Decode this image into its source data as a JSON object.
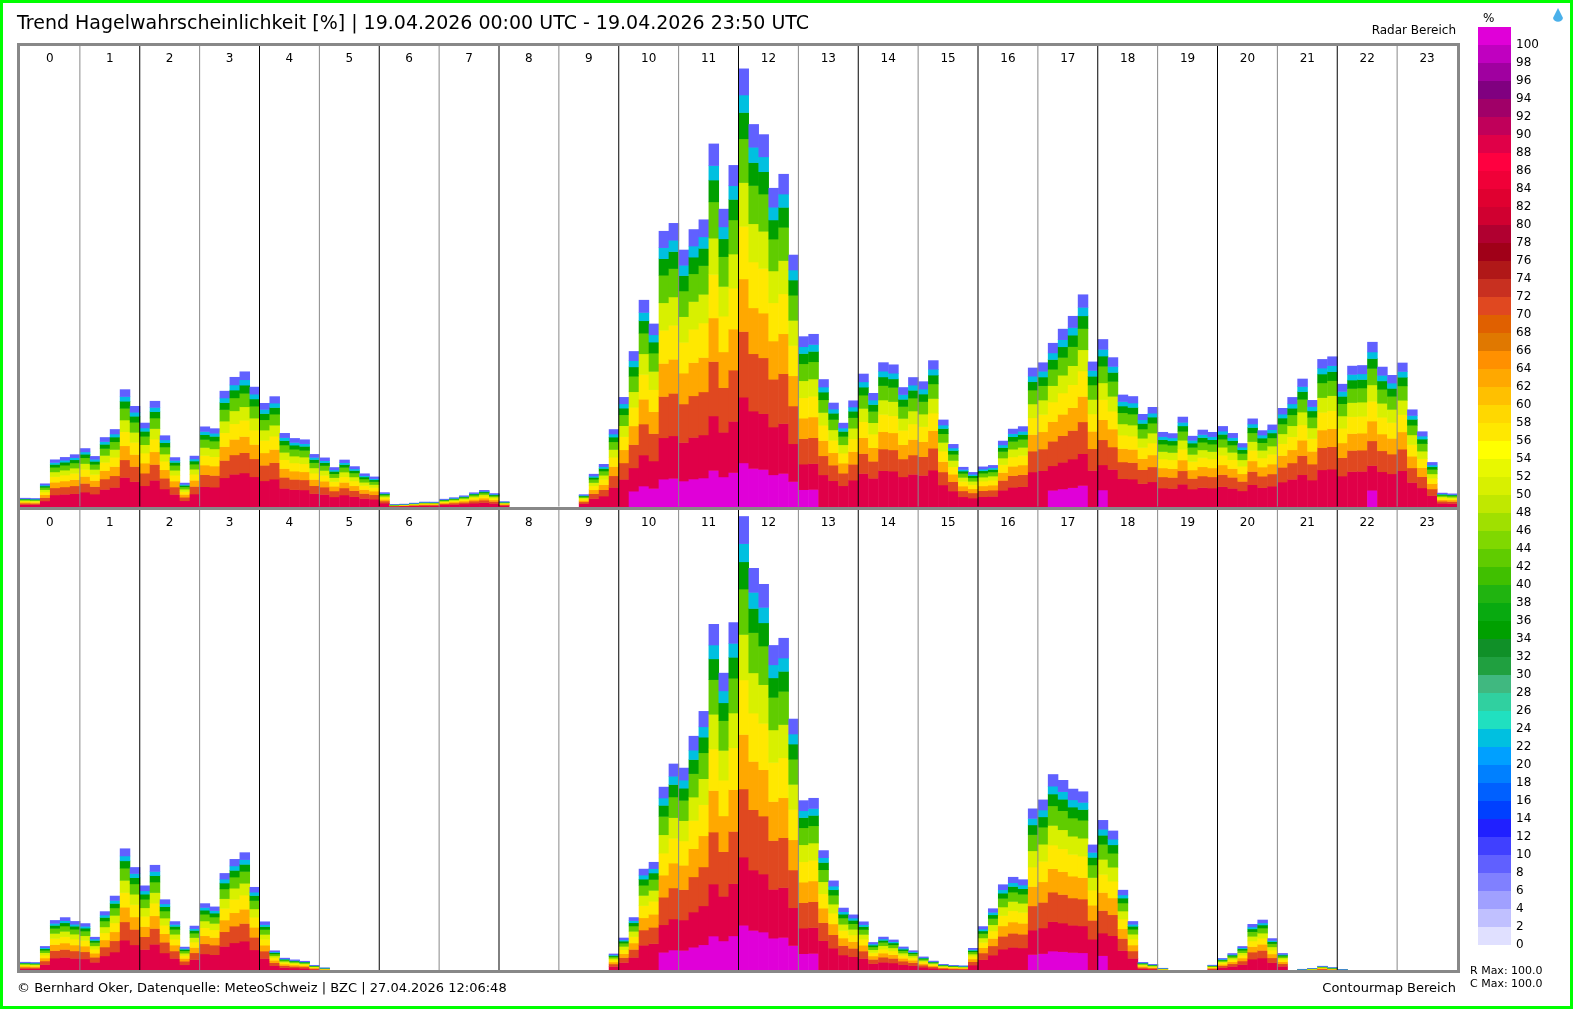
{
  "title": "Trend Hagelwahrscheinlichkeit [%] | 19.04.2026 00:00 UTC - 19.04.2026 23:50 UTC",
  "area_label_top": "Radar Bereich",
  "panels": [
    {
      "hours": [
        "0",
        "1",
        "2",
        "3",
        "4",
        "5",
        "6",
        "7",
        "8",
        "9",
        "10",
        "11",
        "12",
        "13",
        "14",
        "15",
        "16",
        "17",
        "18",
        "19",
        "20",
        "21",
        "22",
        "23"
      ]
    },
    {
      "hours": [
        "0",
        "1",
        "2",
        "3",
        "4",
        "5",
        "6",
        "7",
        "8",
        "9",
        "10",
        "11",
        "12",
        "13",
        "14",
        "15",
        "16",
        "17",
        "18",
        "19",
        "20",
        "21",
        "22",
        "23"
      ]
    }
  ],
  "legend": {
    "unit": "%",
    "items": [
      {
        "label": "100",
        "color": "#e000d8"
      },
      {
        "label": "98",
        "color": "#c000c0"
      },
      {
        "label": "96",
        "color": "#a000a0"
      },
      {
        "label": "94",
        "color": "#800080"
      },
      {
        "label": "92",
        "color": "#a00068"
      },
      {
        "label": "90",
        "color": "#c0005a"
      },
      {
        "label": "88",
        "color": "#e00048"
      },
      {
        "label": "86",
        "color": "#ff0040"
      },
      {
        "label": "84",
        "color": "#f00038"
      },
      {
        "label": "82",
        "color": "#e00030"
      },
      {
        "label": "80",
        "color": "#d00030"
      },
      {
        "label": "78",
        "color": "#b00030"
      },
      {
        "label": "76",
        "color": "#a00018"
      },
      {
        "label": "74",
        "color": "#b01818"
      },
      {
        "label": "72",
        "color": "#c83020"
      },
      {
        "label": "70",
        "color": "#e04820"
      },
      {
        "label": "68",
        "color": "#e06000"
      },
      {
        "label": "66",
        "color": "#e07800"
      },
      {
        "label": "64",
        "color": "#ff9000"
      },
      {
        "label": "62",
        "color": "#ffa800"
      },
      {
        "label": "60",
        "color": "#ffc000"
      },
      {
        "label": "58",
        "color": "#ffd800"
      },
      {
        "label": "56",
        "color": "#ffe800"
      },
      {
        "label": "54",
        "color": "#ffff00"
      },
      {
        "label": "52",
        "color": "#e8f800"
      },
      {
        "label": "50",
        "color": "#d8f000"
      },
      {
        "label": "48",
        "color": "#c0e800"
      },
      {
        "label": "46",
        "color": "#a0e000"
      },
      {
        "label": "44",
        "color": "#80d800"
      },
      {
        "label": "42",
        "color": "#60cc00"
      },
      {
        "label": "40",
        "color": "#40c000"
      },
      {
        "label": "38",
        "color": "#20b410"
      },
      {
        "label": "36",
        "color": "#08aa10"
      },
      {
        "label": "34",
        "color": "#00a000"
      },
      {
        "label": "32",
        "color": "#109028"
      },
      {
        "label": "30",
        "color": "#20a040"
      },
      {
        "label": "28",
        "color": "#40b880"
      },
      {
        "label": "26",
        "color": "#30d0a0"
      },
      {
        "label": "24",
        "color": "#20e0c0"
      },
      {
        "label": "22",
        "color": "#00c0e0"
      },
      {
        "label": "20",
        "color": "#00a0ff"
      },
      {
        "label": "18",
        "color": "#0080ff"
      },
      {
        "label": "16",
        "color": "#0060ff"
      },
      {
        "label": "14",
        "color": "#0040ff"
      },
      {
        "label": "12",
        "color": "#2020ff"
      },
      {
        "label": "10",
        "color": "#4040ff"
      },
      {
        "label": "8",
        "color": "#6060ff"
      },
      {
        "label": "6",
        "color": "#8080ff"
      },
      {
        "label": "4",
        "color": "#a0a0ff"
      },
      {
        "label": "2",
        "color": "#c0c0ff"
      },
      {
        "label": "0",
        "color": "#e0e0ff"
      }
    ],
    "r_max": "R Max: 100.0",
    "c_max": "C Max: 100.0"
  },
  "footer": {
    "credit": "© Bernhard Oker, Datenquelle: MeteoSchweiz | BZC | 27.04.2026 12:06:48",
    "area_label_bottom": "Contourmap Bereich"
  }
}
